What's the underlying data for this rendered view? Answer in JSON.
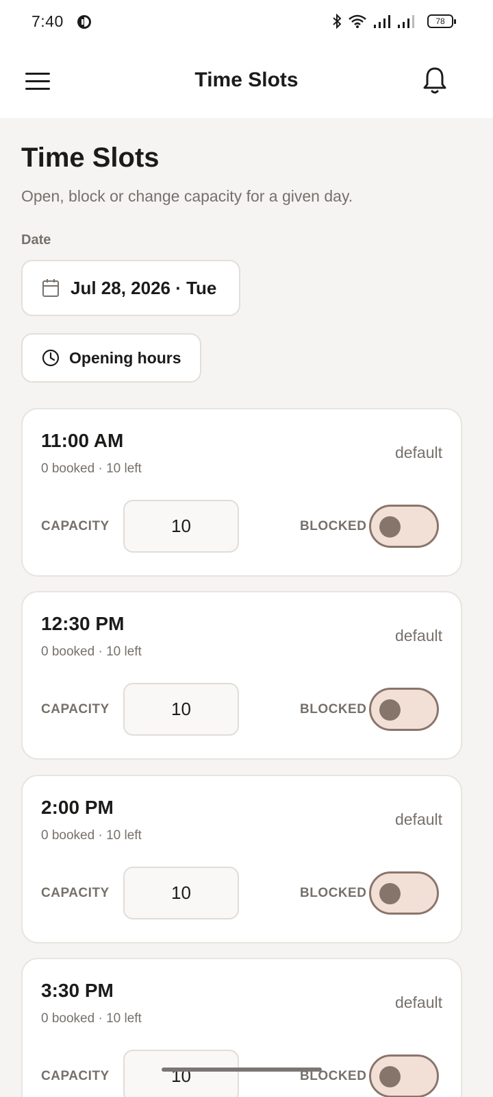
{
  "status_bar": {
    "time": "7:40",
    "battery": "78",
    "icons": [
      "bluetooth-icon",
      "wifi-icon",
      "signal-icon",
      "signal-icon"
    ]
  },
  "app_bar": {
    "title": "Time Slots",
    "icons": [
      "menu-icon",
      "bell-icon"
    ]
  },
  "page": {
    "heading": "Time Slots",
    "subtitle": "Open, block or change capacity for a given day.",
    "date_label": "Date",
    "date_value": "Jul 28, 2026 · Tue",
    "opening_hours_label": "Opening hours"
  },
  "slot_labels": {
    "capacity": "CAPACITY",
    "blocked": "BLOCKED"
  },
  "slots": [
    {
      "time": "11:00 AM",
      "meta": "0 booked · 10 left",
      "state": "default",
      "capacity": "10",
      "blocked": false
    },
    {
      "time": "12:30 PM",
      "meta": "0 booked · 10 left",
      "state": "default",
      "capacity": "10",
      "blocked": false
    },
    {
      "time": "2:00 PM",
      "meta": "0 booked · 10 left",
      "state": "default",
      "capacity": "10",
      "blocked": false
    },
    {
      "time": "3:30 PM",
      "meta": "0 booked · 10 left",
      "state": "default",
      "capacity": "10",
      "blocked": false
    }
  ],
  "colors": {
    "background": "#f5f4f2",
    "card": "#ffffff",
    "toggle_track": "#f2dfd6",
    "toggle_border": "#8a756b",
    "muted_text": "#76706b"
  }
}
